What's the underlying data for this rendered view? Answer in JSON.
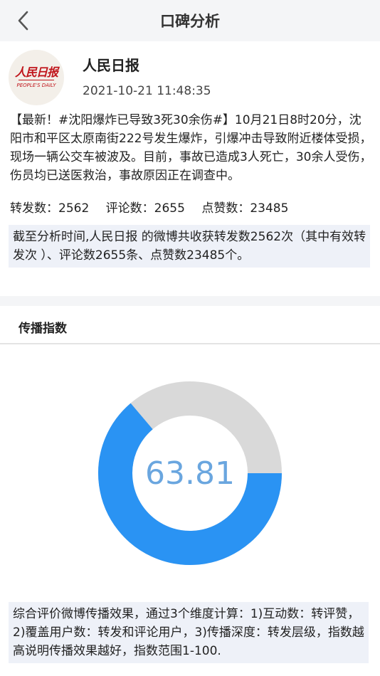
{
  "nav": {
    "title": "口碑分析",
    "back_icon": "chevron-left-icon"
  },
  "post": {
    "avatar": {
      "logo_cn": "人民日报",
      "logo_en": "PEOPLE'S DAILY"
    },
    "author": "人民日报",
    "time": "2021-10-21 11:48:35",
    "content": "【最新！#沈阳爆炸已导致3死30余伤#】10月21日8时20分，沈阳市和平区太原南街222号发生爆炸，引爆冲击导致附近楼体受损，现场一辆公交车被波及。目前，事故已造成3人死亡，30余人受伤，伤员均已送医救治，事故原因正在调查中。",
    "stats": {
      "forwards": "转发数：2562",
      "comments": "评论数：2655",
      "likes": "点赞数：23485"
    },
    "summary": "截至分析时间,人民日报 的微博共收获转发数2562次（其中有效转发次 ）、评论数2655条、点赞数23485个。"
  },
  "spread": {
    "title": "传播指数",
    "value": 63.81,
    "value_label": "63.81",
    "max": 100,
    "colors": {
      "fill": "#2a93f3",
      "track": "#d9d9d9",
      "value_text": "#6aa6df"
    },
    "description": "综合评价微博传播效果，通过3个维度计算：1)互动数：转评赞，2)覆盖用户数：转发和评论用户，3)传播深度：转发层级，指数越高说明传播效果越好，指数范围1-100."
  }
}
